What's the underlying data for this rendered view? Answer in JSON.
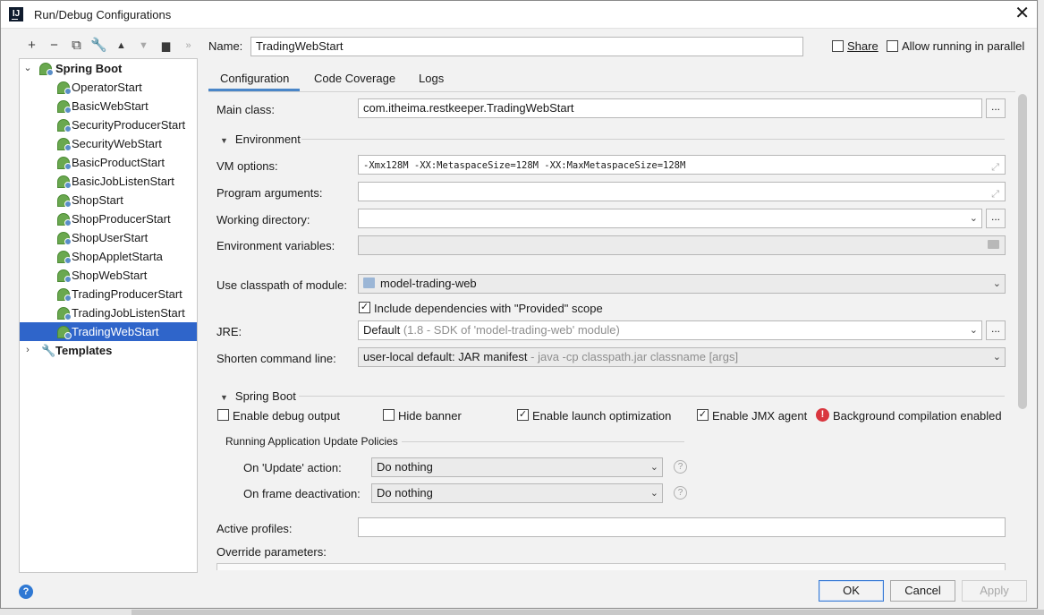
{
  "window": {
    "title": "Run/Debug Configurations"
  },
  "toolbar": {
    "items": [
      {
        "name": "add",
        "glyph": "+"
      },
      {
        "name": "remove",
        "glyph": "−"
      },
      {
        "name": "copy",
        "glyph": "⧉"
      },
      {
        "name": "edit-defaults",
        "glyph": "🔧"
      },
      {
        "name": "move-up",
        "glyph": "▲"
      },
      {
        "name": "move-down",
        "glyph": "▼"
      },
      {
        "name": "folder",
        "glyph": "📁"
      },
      {
        "name": "more",
        "glyph": "»"
      }
    ]
  },
  "tree": {
    "root": "Spring Boot",
    "items": [
      "OperatorStart",
      "BasicWebStart",
      "SecurityProducerStart",
      "SecurityWebStart",
      "BasicProductStart",
      "BasicJobListenStart",
      "ShopStart",
      "ShopProducerStart",
      "ShopUserStart",
      "ShopAppletStarta",
      "ShopWebStart",
      "TradingProducerStart",
      "TradingJobListenStart",
      "TradingWebStart"
    ],
    "selected_index": 13,
    "templates": "Templates"
  },
  "name_row": {
    "label": "Name:",
    "value": "TradingWebStart",
    "share": "Share",
    "allow_parallel": "Allow running in parallel"
  },
  "tabs": [
    "Configuration",
    "Code Coverage",
    "Logs"
  ],
  "config": {
    "main_class_label": "Main class:",
    "main_class_value": "com.itheima.restkeeper.TradingWebStart",
    "environment_header": "Environment",
    "vm_options_label": "VM options:",
    "vm_options_value": "-Xmx128M -XX:MetaspaceSize=128M -XX:MaxMetaspaceSize=128M",
    "program_args_label": "Program arguments:",
    "working_dir_label": "Working directory:",
    "env_vars_label": "Environment variables:",
    "classpath_label": "Use classpath of module:",
    "classpath_value": "model-trading-web",
    "include_provided": "Include dependencies with \"Provided\" scope",
    "jre_label": "JRE:",
    "jre_value": "Default",
    "jre_hint": "(1.8 - SDK of 'model-trading-web' module)",
    "shorten_label": "Shorten command line:",
    "shorten_value": "user-local default: JAR manifest",
    "shorten_hint": "- java -cp classpath.jar classname [args]",
    "spring_boot_header": "Spring Boot",
    "enable_debug": "Enable debug output",
    "hide_banner": "Hide banner",
    "enable_launch": "Enable launch optimization",
    "enable_jmx": "Enable JMX agent",
    "bg_compile": "Background compilation enabled",
    "update_policies_header": "Running Application Update Policies",
    "on_update_label": "On 'Update' action:",
    "on_update_value": "Do nothing",
    "on_frame_label": "On frame deactivation:",
    "on_frame_value": "Do nothing",
    "active_profiles_label": "Active profiles:",
    "override_label": "Override parameters:"
  },
  "buttons": {
    "ok": "OK",
    "cancel": "Cancel",
    "apply": "Apply"
  },
  "colors": {
    "selection": "#2f65ca",
    "accent": "#4a86c8",
    "error": "#d9363e",
    "help": "#2f78d3"
  }
}
